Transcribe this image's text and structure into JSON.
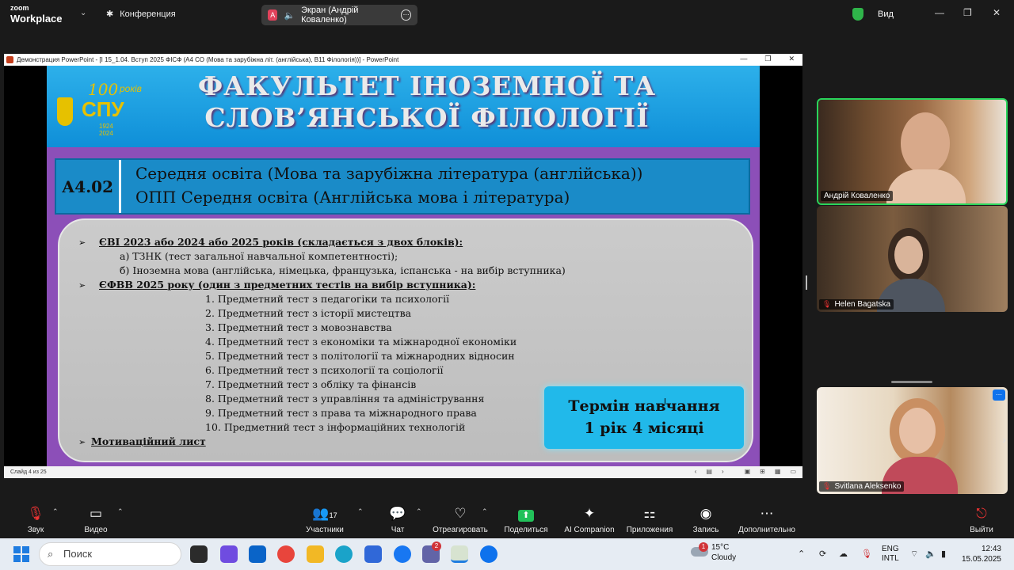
{
  "zoom": {
    "brand_top": "zoom",
    "brand_bottom": "Workplace",
    "meeting_label": "Конференция",
    "share_avatar": "A",
    "share_label": "Экран (Андрій Коваленко)",
    "view_label": "Вид",
    "accent": "#22c15a",
    "toolbar": [
      {
        "icon": "mic-muted-icon",
        "glyph": "🎙",
        "label": "Звук"
      },
      {
        "icon": "video-icon",
        "glyph": "▭",
        "label": "Видео"
      },
      {
        "icon": "participants-icon",
        "glyph": "👥",
        "label": "Участники",
        "count": "17"
      },
      {
        "icon": "chat-icon",
        "glyph": "💬",
        "label": "Чат"
      },
      {
        "icon": "react-icon",
        "glyph": "♡",
        "label": "Отреагировать"
      },
      {
        "icon": "share-icon",
        "glyph": "⬆",
        "label": "Поделиться"
      },
      {
        "icon": "ai-companion-icon",
        "glyph": "✦",
        "label": "AI Companion"
      },
      {
        "icon": "apps-icon",
        "glyph": "⚏",
        "label": "Приложения"
      },
      {
        "icon": "record-icon",
        "glyph": "◉",
        "label": "Запись"
      },
      {
        "icon": "more-icon",
        "glyph": "⋯",
        "label": "Дополнительно"
      },
      {
        "icon": "leave-icon",
        "glyph": "⎋",
        "label": "Выйти"
      }
    ]
  },
  "ppt": {
    "window_title": "Демонстрация PowerPoint - [I 15_1.04. Вступ 2025 ФІСФ (А4 СО (Мова та зарубіжна літ. (англійська), В11 Філологія))] - PowerPoint",
    "status": "Слайд 4 из 25"
  },
  "slide": {
    "title_line1": "ФАКУЛЬТЕТ ІНОЗЕМНОЇ ТА",
    "title_line2": "СЛОВ’ЯНСЬКОЇ ФІЛОЛОГІЇ",
    "logo_hundred": "100",
    "logo_years": "років",
    "logo_spu": "СПУ",
    "logo_dates": "1924\n2024",
    "program_code": "А4.02",
    "program_line1": "Середня освіта (Мова та зарубіжна література (англійська))",
    "program_line2": "ОПП Середня освіта (Англійська мова і література)",
    "evi_heading": "ЄВІ 2023 або 2024 або 2025 років (складається з двох блоків):",
    "evi_a": "а) ТЗНК (тест загальної навчальної компетентності);",
    "evi_b": "б) Іноземна мова (англійська, німецька, французька, іспанська - на вибір вступника)",
    "efvv_heading": "ЄФВВ 2025 року (один з предметних тестів на вибір вступника):",
    "tests": [
      "1. Предметний тест з педагогіки та психології",
      "2. Предметний тест з історії мистецтва",
      "3. Предметний тест з мовознавства",
      "4. Предметний тест з економіки та міжнародної економіки",
      "5. Предметний тест з політології та міжнародних відносин",
      "6. Предметний тест з психології та соціології",
      "7. Предметний тест з обліку та фінансів",
      "8. Предметний тест з управління та адміністрування",
      "9. Предметний тест з права та міжнародного права",
      "10. Предметний тест з інформаційних технологій"
    ],
    "motivation": "Мотиваційний лист",
    "term_line1": "Термін навчання",
    "term_line2": "1 рік 4 місяці"
  },
  "participants": [
    {
      "name": "Андрій Коваленко",
      "muted": false
    },
    {
      "name": "Helen Bagatska",
      "muted": true
    },
    {
      "name": "Svitlana Aleksenko",
      "muted": true
    }
  ],
  "taskbar": {
    "search_placeholder": "Поиск",
    "weather_temp": "15°C",
    "weather_desc": "Cloudy",
    "weather_badge": "1",
    "lang_top": "ENG",
    "lang_bottom": "INTL",
    "time": "12:43",
    "date": "15.05.2025",
    "teams_badge": "2"
  }
}
